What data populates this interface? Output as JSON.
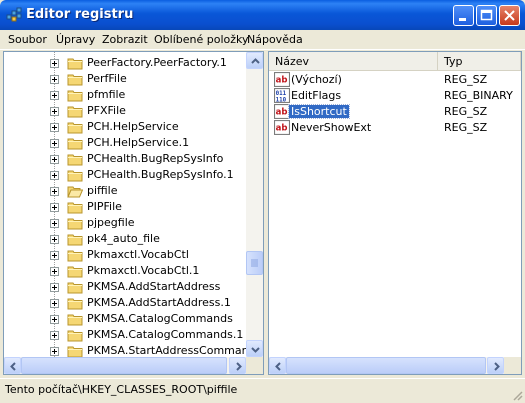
{
  "window": {
    "title": "Editor registru",
    "controls": [
      "minimize-icon",
      "maximize-icon",
      "close-icon"
    ]
  },
  "menu": [
    "Soubor",
    "Úpravy",
    "Zobrazit",
    "Oblíbené položky",
    "Nápověda"
  ],
  "tree": {
    "items": [
      {
        "label": "PeerFactory.PeerFactory.1",
        "open": false
      },
      {
        "label": "PerfFile",
        "open": false
      },
      {
        "label": "pfmfile",
        "open": false
      },
      {
        "label": "PFXFile",
        "open": false
      },
      {
        "label": "PCH.HelpService",
        "open": false
      },
      {
        "label": "PCH.HelpService.1",
        "open": false
      },
      {
        "label": "PCHealth.BugRepSysInfo",
        "open": false
      },
      {
        "label": "PCHealth.BugRepSysInfo.1",
        "open": false
      },
      {
        "label": "piffile",
        "open": true
      },
      {
        "label": "PIPFile",
        "open": false
      },
      {
        "label": "pjpegfile",
        "open": false
      },
      {
        "label": "pk4_auto_file",
        "open": false
      },
      {
        "label": "Pkmaxctl.VocabCtl",
        "open": false
      },
      {
        "label": "Pkmaxctl.VocabCtl.1",
        "open": false
      },
      {
        "label": "PKMSA.AddStartAddress",
        "open": false
      },
      {
        "label": "PKMSA.AddStartAddress.1",
        "open": false
      },
      {
        "label": "PKMSA.CatalogCommands",
        "open": false
      },
      {
        "label": "PKMSA.CatalogCommands.1",
        "open": false
      },
      {
        "label": "PKMSA.StartAddressCommands",
        "open": false
      }
    ]
  },
  "list": {
    "columns": [
      "Název",
      "Typ"
    ],
    "rows": [
      {
        "name": "(Výchozí)",
        "type": "REG_SZ",
        "icon": "string-value-icon"
      },
      {
        "name": "EditFlags",
        "type": "REG_BINARY",
        "icon": "binary-value-icon"
      },
      {
        "name": "IsShortcut",
        "type": "REG_SZ",
        "icon": "string-value-icon",
        "selected": true
      },
      {
        "name": "NeverShowExt",
        "type": "REG_SZ",
        "icon": "string-value-icon"
      }
    ]
  },
  "status": {
    "path": "Tento počítač\\HKEY_CLASSES_ROOT\\piffile"
  },
  "colors": {
    "titlebar": "#0a5ee0",
    "selection": "#316ac5",
    "folder": "#f5d774"
  }
}
